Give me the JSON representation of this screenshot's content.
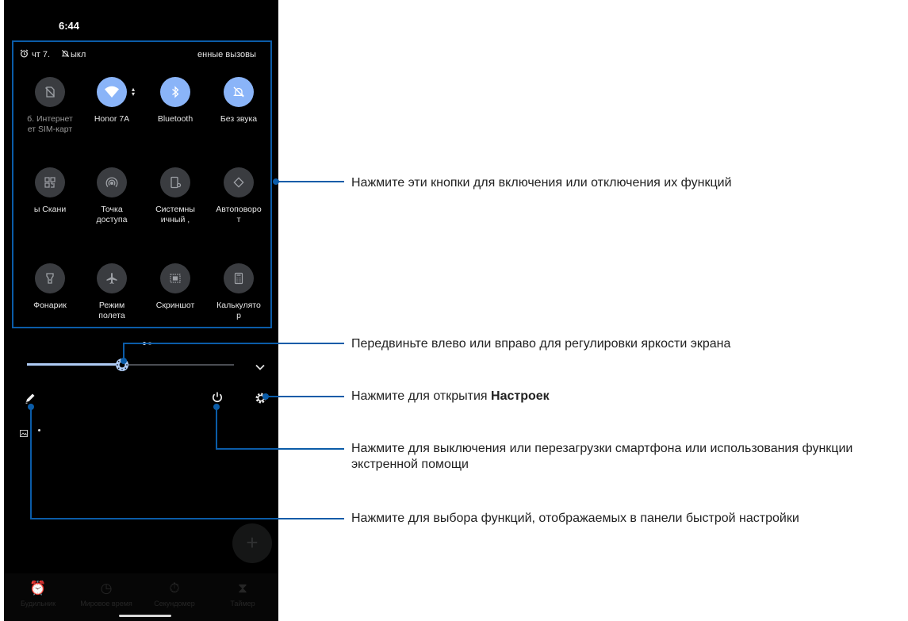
{
  "status_bar": {
    "time": "6:44",
    "date": "чт 7.",
    "mute_text": "ыкл",
    "calls_text": "енные вызовы"
  },
  "quick_tiles": [
    {
      "icon": "no-sim-icon",
      "label": "б. Интернет\nет SIM-карт",
      "active": false,
      "dim": true
    },
    {
      "icon": "wifi-icon",
      "label": "Honor 7A",
      "active": true,
      "dim": false
    },
    {
      "icon": "bluetooth-icon",
      "label": "Bluetooth",
      "active": true,
      "dim": false
    },
    {
      "icon": "mute-icon",
      "label": "Без звука",
      "active": true,
      "dim": false
    },
    {
      "icon": "qr-scan-icon",
      "label": "ы     Скани",
      "active": false,
      "dim": false
    },
    {
      "icon": "hotspot-icon",
      "label": "Точка\nдоступа",
      "active": false,
      "dim": false
    },
    {
      "icon": "system-settings-icon",
      "label": "Системны\nичный    ,",
      "active": false,
      "dim": false
    },
    {
      "icon": "auto-rotate-icon",
      "label": "Автоповоро\nт",
      "active": false,
      "dim": false
    },
    {
      "icon": "flashlight-icon",
      "label": "Фонарик",
      "active": false,
      "dim": false
    },
    {
      "icon": "airplane-icon",
      "label": "Режим\nполета",
      "active": false,
      "dim": false
    },
    {
      "icon": "screenshot-icon",
      "label": "Скриншот",
      "active": false,
      "dim": false
    },
    {
      "icon": "calculator-icon",
      "label": "Калькулято\nр",
      "active": false,
      "dim": false
    }
  ],
  "page_indicator": {
    "pages": 2,
    "current": 1
  },
  "brightness": {
    "level": 0.46
  },
  "bottom_nav": [
    {
      "icon": "alarm-icon",
      "label": "Будильник"
    },
    {
      "icon": "clock-icon",
      "label": "Мировое время"
    },
    {
      "icon": "stopwatch-icon",
      "label": "Секундомер"
    },
    {
      "icon": "timer-icon",
      "label": "Таймер"
    }
  ],
  "fab_symbol": "+",
  "annotations": {
    "tiles": "Нажмите эти кнопки для включения или отключения их функций",
    "brightness": "Передвиньте влево или вправо для регулировки яркости экрана",
    "settings_prefix": "Нажмите для открытия ",
    "settings_bold": "Настроек",
    "power": "Нажмите для выключения или перезагрузки смартфона или использования функции экстренной помощи",
    "edit": "Нажмите для выбора функций, отображаемых в панели быстрой настройки"
  },
  "colors": {
    "callout": "#0b5ca8",
    "tile_active": "#8ab4f8",
    "tile_inactive": "#3a3c40",
    "panel_bg": "#000000"
  }
}
